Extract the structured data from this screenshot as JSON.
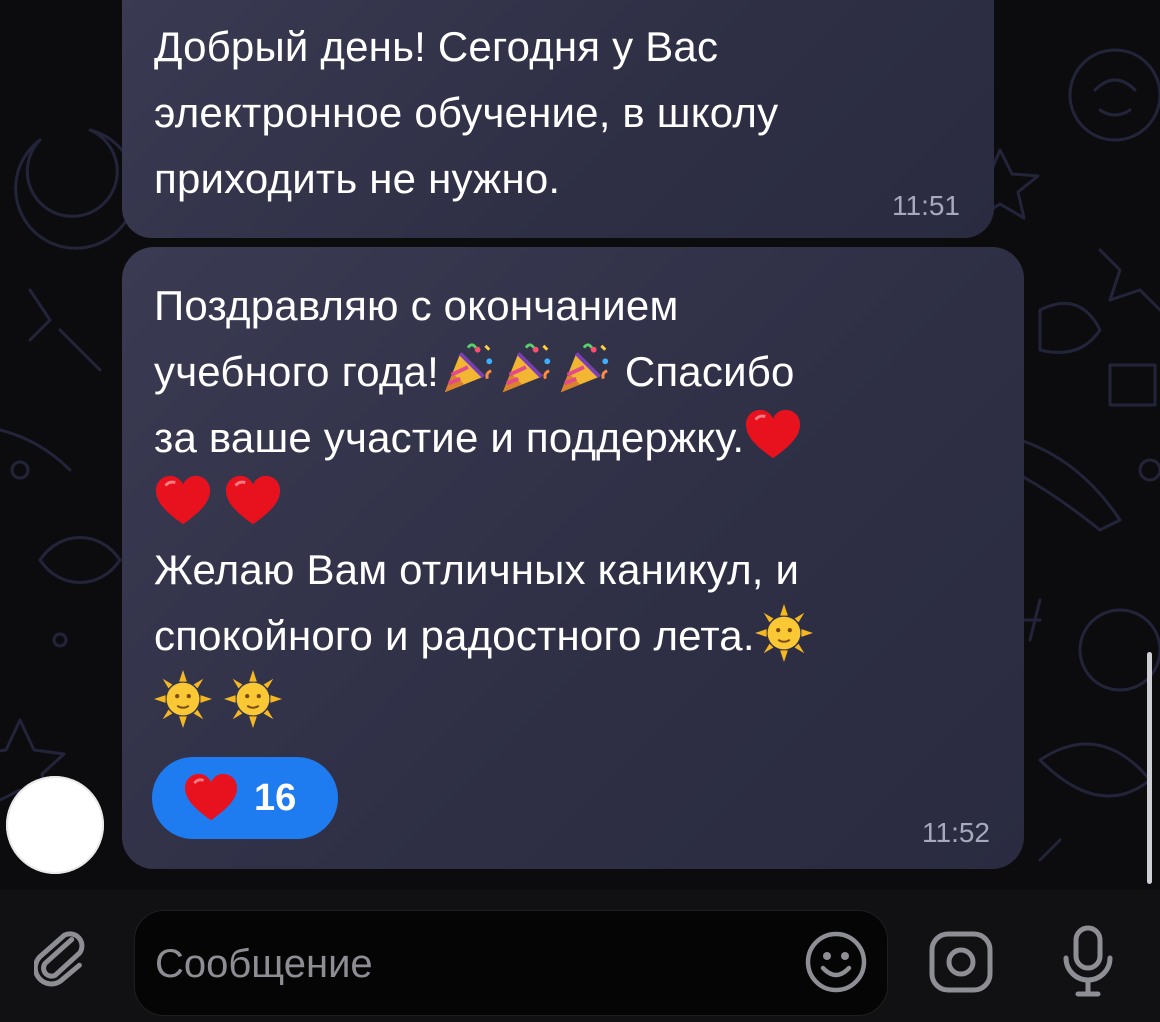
{
  "messages": [
    {
      "text": "Добрый день! Сегодня у Вас электронное обучение, в школу приходить не нужно.",
      "time": "11:51"
    },
    {
      "line1": "Поздравляю с окончанием",
      "line2_a": "учебного года!",
      "line2_b": " Спасибо",
      "line3": "за ваше участие и поддержку.",
      "line5": "Желаю Вам отличных каникул, и",
      "line6": "спокойного и радостного лета.",
      "time": "11:52",
      "reaction": {
        "emoji": "heart",
        "count": "16"
      }
    }
  ],
  "composer": {
    "placeholder": "Сообщение"
  },
  "colors": {
    "bubble": "#34354c",
    "reaction": "#1f7bf0",
    "time": "#a7a9bd",
    "background": "#0c0c0f"
  },
  "icons": {
    "attach": "paperclip-icon",
    "emoji": "smiley-icon",
    "camera": "camera-icon",
    "mic": "microphone-icon",
    "party": "party-popper-icon",
    "heart": "red-heart-icon",
    "sun": "sun-with-face-icon"
  }
}
